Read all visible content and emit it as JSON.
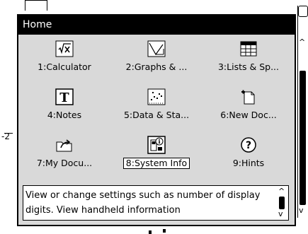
{
  "window": {
    "title": "Home"
  },
  "apps": [
    {
      "label": "1:Calculator",
      "icon": "calculator-icon"
    },
    {
      "label": "2:Graphs & ...",
      "icon": "graphs-icon"
    },
    {
      "label": "3:Lists & Sp...",
      "icon": "spreadsheet-icon"
    },
    {
      "label": "4:Notes",
      "icon": "notes-icon"
    },
    {
      "label": "5:Data & Sta...",
      "icon": "data-stats-icon"
    },
    {
      "label": "6:New Doc...",
      "icon": "new-document-icon"
    },
    {
      "label": "7:My Docu...",
      "icon": "my-documents-icon"
    },
    {
      "label": "8:System Info",
      "icon": "system-info-icon"
    },
    {
      "label": "9:Hints",
      "icon": "hints-icon"
    }
  ],
  "selected_index": 7,
  "description": "View or change settings such as number of display digits.  View handheld information",
  "background": {
    "left_label": "-2"
  },
  "colors": {
    "titlebar": "#000000",
    "dialog_bg": "#d9d9d9",
    "text": "#000000"
  }
}
